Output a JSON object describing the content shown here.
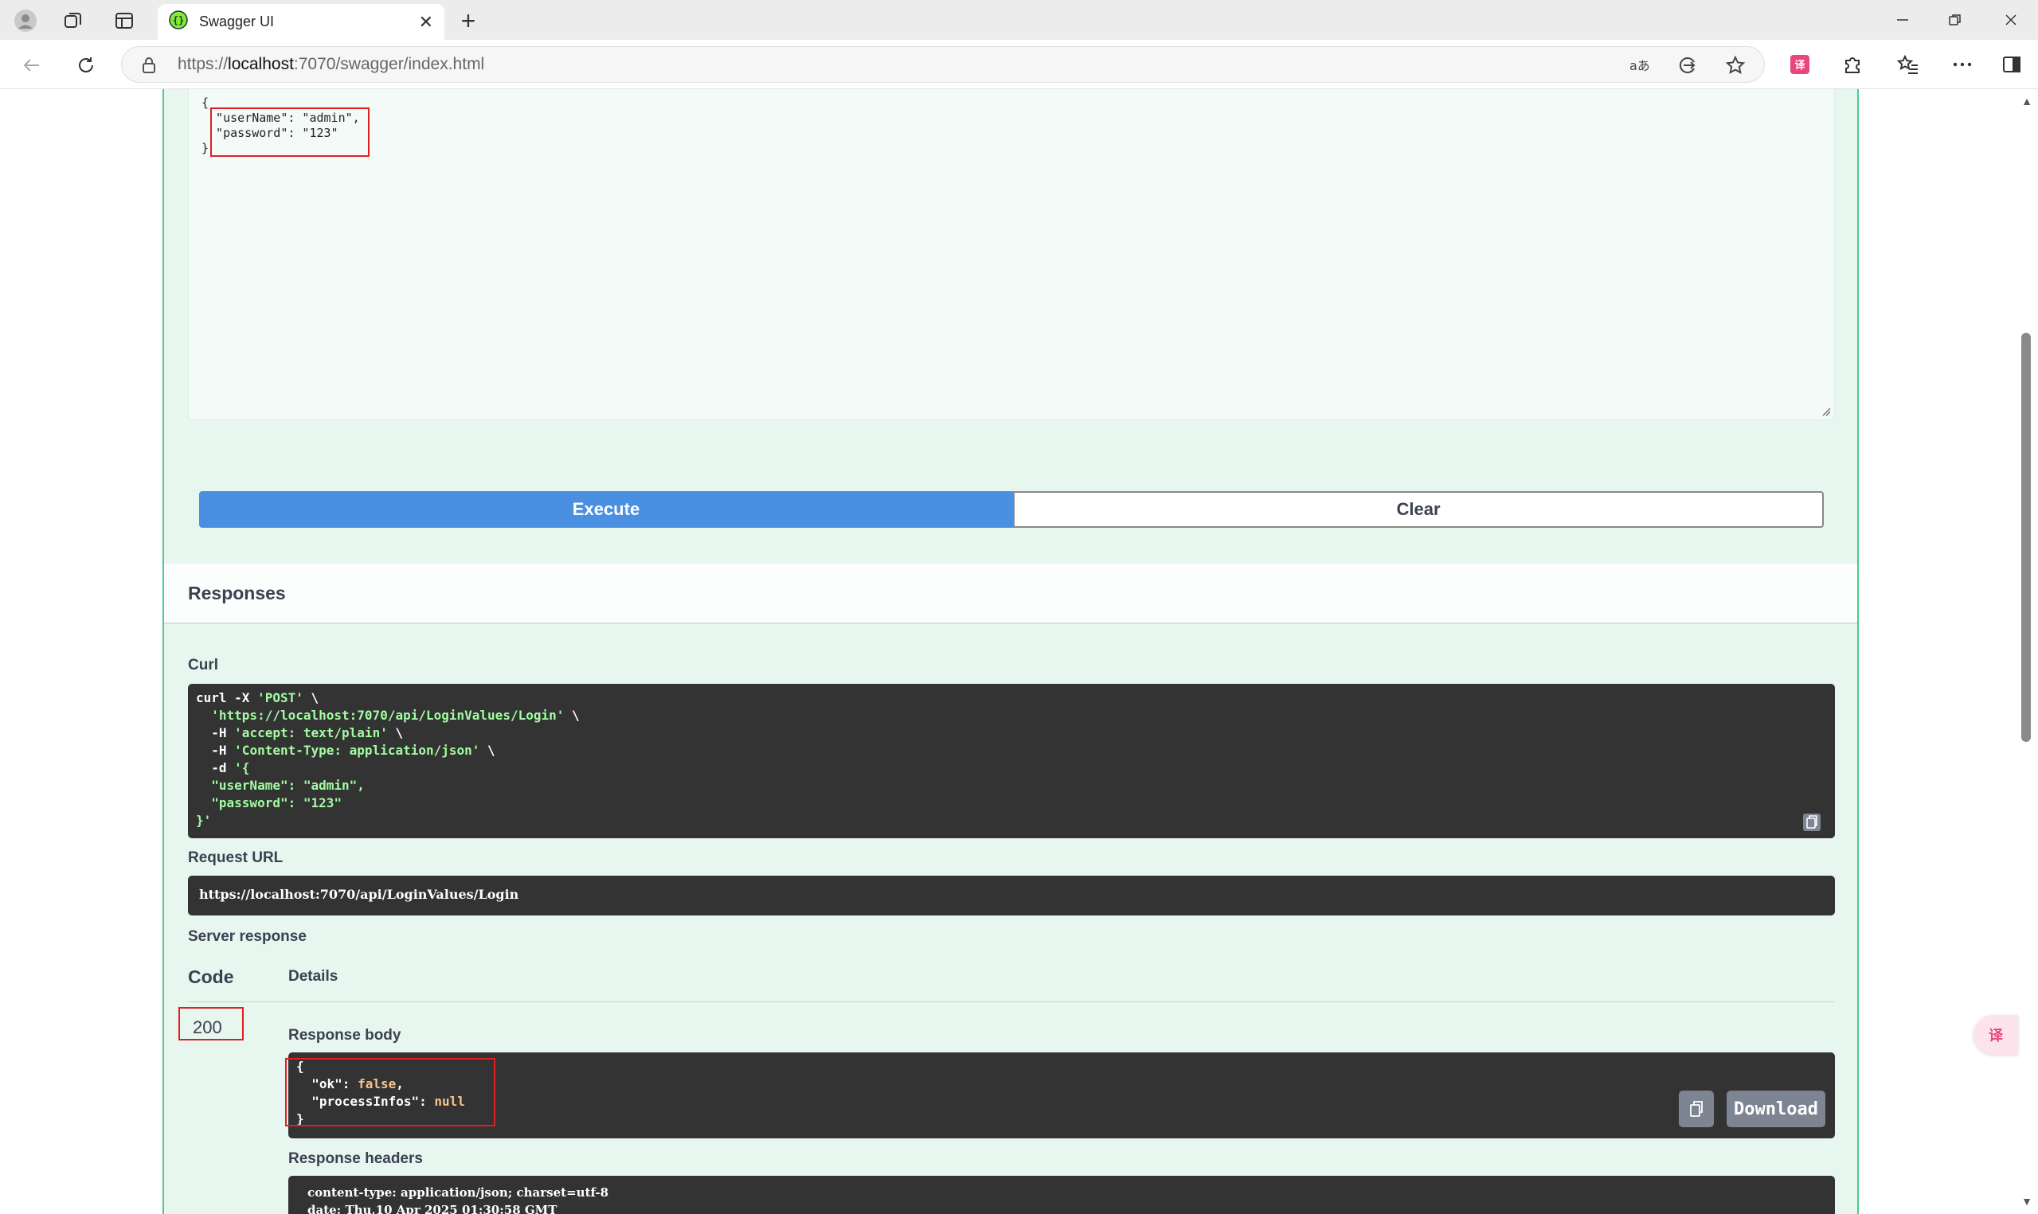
{
  "browser": {
    "tab_title": "Swagger UI",
    "url_prefix": "https://",
    "url_host": "localhost",
    "url_rest": ":7070/swagger/index.html"
  },
  "request_body": {
    "lines": [
      "{",
      "  \"userName\": \"admin\",",
      "  \"password\": \"123\"",
      "}"
    ]
  },
  "buttons": {
    "execute": "Execute",
    "clear": "Clear",
    "download": "Download"
  },
  "responses": {
    "title": "Responses",
    "curl_label": "Curl",
    "curl_lines": [
      [
        {
          "t": "curl -X ",
          "c": "white"
        },
        {
          "t": "'POST'",
          "c": "green"
        },
        {
          "t": " \\",
          "c": "white"
        }
      ],
      [
        {
          "t": "  ",
          "c": "white"
        },
        {
          "t": "'https://localhost:7070/api/LoginValues/Login'",
          "c": "green"
        },
        {
          "t": " \\",
          "c": "white"
        }
      ],
      [
        {
          "t": "  -H ",
          "c": "white"
        },
        {
          "t": "'accept: text/plain'",
          "c": "green"
        },
        {
          "t": " \\",
          "c": "white"
        }
      ],
      [
        {
          "t": "  -H ",
          "c": "white"
        },
        {
          "t": "'Content-Type: application/json'",
          "c": "green"
        },
        {
          "t": " \\",
          "c": "white"
        }
      ],
      [
        {
          "t": "  -d ",
          "c": "white"
        },
        {
          "t": "'{",
          "c": "green"
        }
      ],
      [
        {
          "t": "  \"userName\": \"admin\",",
          "c": "green"
        }
      ],
      [
        {
          "t": "  \"password\": \"123\"",
          "c": "green"
        }
      ],
      [
        {
          "t": "}'",
          "c": "green"
        }
      ]
    ],
    "request_url_label": "Request URL",
    "request_url": "https://localhost:7070/api/LoginValues/Login",
    "server_response_label": "Server response",
    "code_header": "Code",
    "details_header": "Details",
    "status_code": "200",
    "response_body_label": "Response body",
    "response_body_lines": [
      [
        {
          "t": "{",
          "c": "white"
        }
      ],
      [
        {
          "t": "  \"ok\": ",
          "c": "white"
        },
        {
          "t": "false",
          "c": "orange"
        },
        {
          "t": ",",
          "c": "white"
        }
      ],
      [
        {
          "t": "  \"processInfos\": ",
          "c": "white"
        },
        {
          "t": "null",
          "c": "orange"
        }
      ],
      [
        {
          "t": "}",
          "c": "white"
        }
      ]
    ],
    "response_headers_label": "Response headers",
    "response_headers_lines": [
      "content-type: application/json; charset=utf-8",
      "date: Thu,10 Apr 2025 01:30:58 GMT"
    ]
  },
  "icons": {
    "profile": "profile-icon",
    "workspaces": "workspaces-icon",
    "tab_actions": "tab-actions-icon",
    "favicon": "swagger-favicon-icon",
    "close": "close-icon",
    "new_tab": "plus-icon",
    "back": "back-arrow-icon",
    "refresh": "refresh-icon",
    "lock": "lock-icon",
    "read_aloud": "read-aloud-icon",
    "browser_essentials": "browser-essentials-icon",
    "favorite": "star-icon",
    "translate_ext": "translate-extension-icon",
    "extensions": "puzzle-icon",
    "favorites": "favorites-icon",
    "more": "more-icon",
    "sidebar": "sidebar-icon",
    "copy": "copy-icon"
  },
  "colors": {
    "post_green": "#49cc90",
    "opblock_bg": "#e8f6f0",
    "execute_blue": "#4990e2",
    "highlight_red": "#e02020",
    "code_bg": "#333333"
  }
}
